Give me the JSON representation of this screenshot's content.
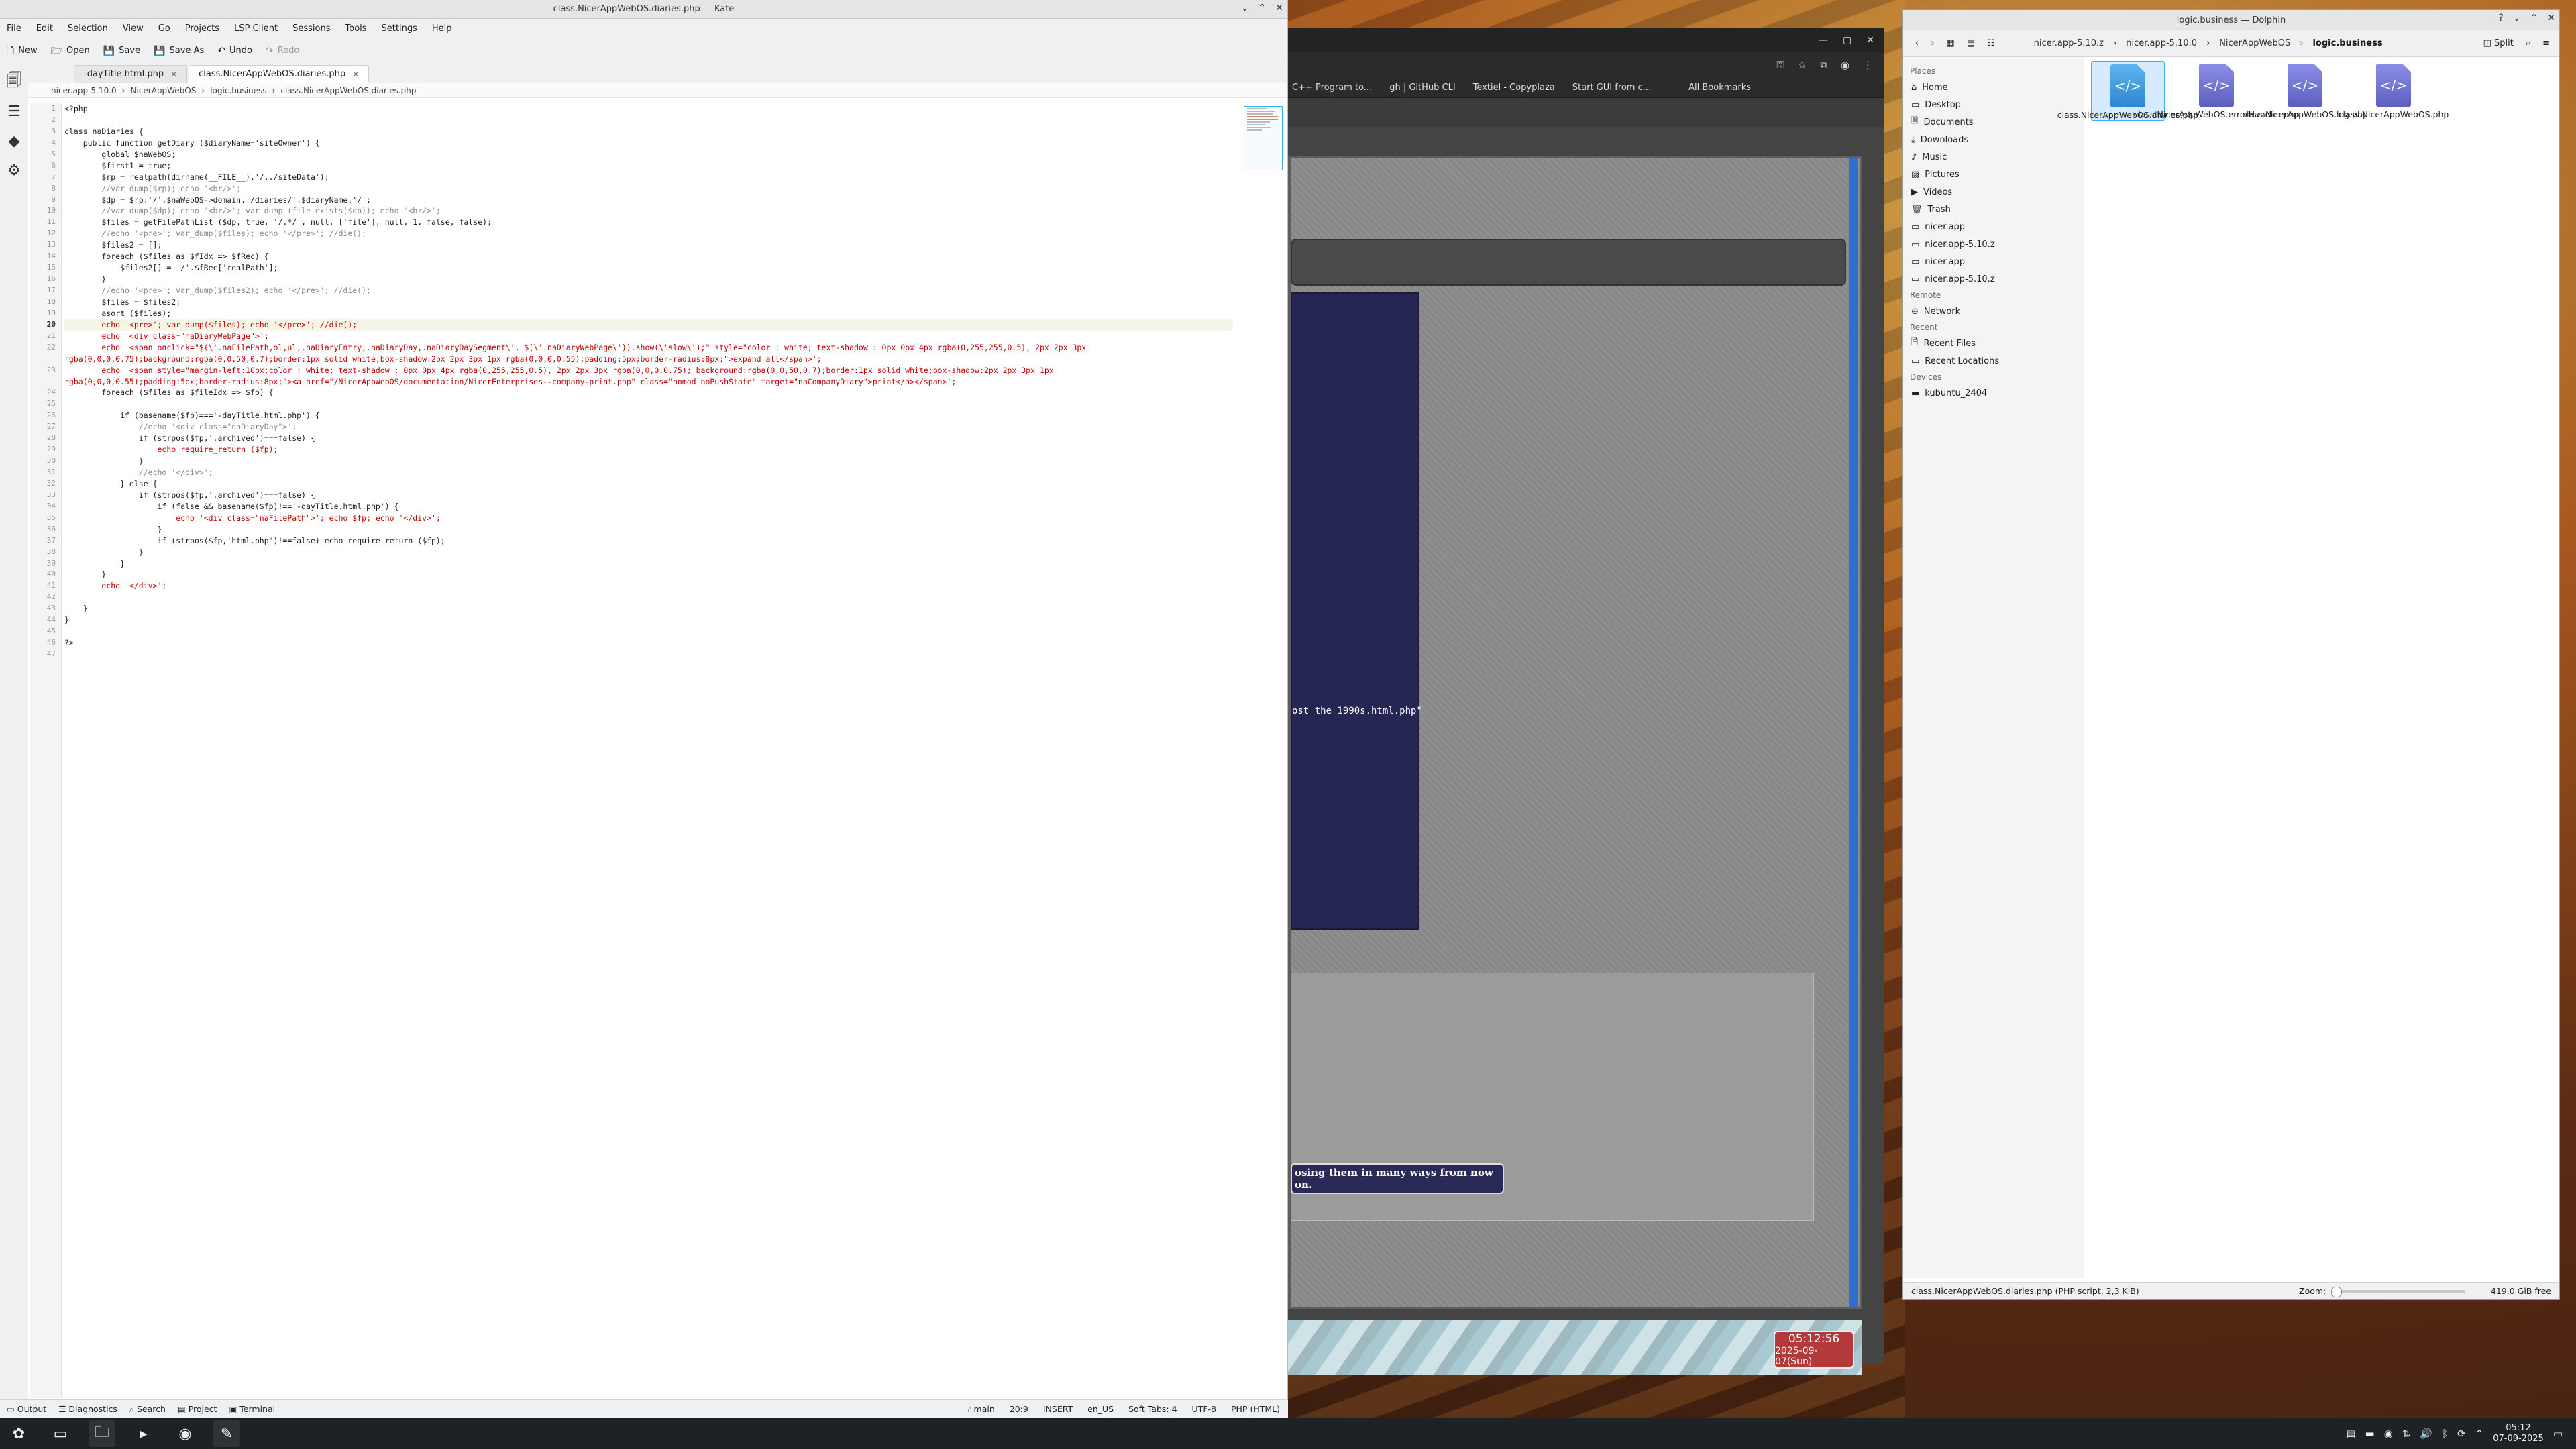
{
  "kate": {
    "title": "class.NicerAppWebOS.diaries.php — Kate",
    "menu": [
      "File",
      "Edit",
      "Selection",
      "View",
      "Go",
      "Projects",
      "LSP Client",
      "Sessions",
      "Tools",
      "Settings",
      "Help"
    ],
    "toolbar": {
      "new": "New",
      "open": "Open",
      "save": "Save",
      "save_as": "Save As",
      "undo": "Undo",
      "redo": "Redo"
    },
    "tabs": [
      "-dayTitle.html.php",
      "class.NicerAppWebOS.diaries.php"
    ],
    "breadcrumb": [
      "nicer.app-5.10.0",
      "NicerAppWebOS",
      "logic.business",
      "class.NicerAppWebOS.diaries.php"
    ],
    "current_line": 20,
    "code_lines": [
      "<?php",
      "",
      "class naDiaries {",
      "    public function getDiary ($diaryName='siteOwner') {",
      "        global $naWebOS;",
      "        $first1 = true;",
      "        $rp = realpath(dirname(__FILE__).'/../siteData');",
      "        //var_dump($rp); echo '<br/>';",
      "        $dp = $rp.'/'.$naWebOS->domain.'/diaries/'.$diaryName.'/';",
      "        //var_dump($dp); echo '<br/>'; var_dump (file_exists($dp)); echo '<br/>';",
      "        $files = getFilePathList ($dp, true, '/.*/', null, ['file'], null, 1, false, false);",
      "        //echo '<pre>'; var_dump($files); echo '</pre>'; //die();",
      "        $files2 = [];",
      "        foreach ($files as $fIdx => $fRec) {",
      "            $files2[] = '/'.$fRec['realPath'];",
      "        }",
      "        //echo '<pre>'; var_dump($files2); echo '</pre>'; //die();",
      "        $files = $files2;",
      "        asort ($files);",
      "        echo '<pre>'; var_dump($files); echo '</pre>'; //die();",
      "        echo '<div class=\"naDiaryWebPage\">';",
      "        echo '<span onclick=\"$(\\'.naFilePath,ol,ul,.naDiaryEntry,.naDiaryDay,.naDiaryDaySegment\\', $(\\'.naDiaryWebPage\\')).show(\\'slow\\');\" style=\"color : white; text-shadow : 0px 0px 4px rgba(0,255,255,0.5), 2px 2px 3px",
      "rgba(0,0,0,0.75);background:rgba(0,0,50,0.7);border:1px solid white;box-shadow:2px 2px 3px 1px rgba(0,0,0,0.55);padding:5px;border-radius:8px;\">expand all</span>';",
      "        echo '<span style=\"margin-left:10px;color : white; text-shadow : 0px 0px 4px rgba(0,255,255,0.5), 2px 2px 3px rgba(0,0,0,0.75); background:rgba(0,0,50,0.7);border:1px solid white;box-shadow:2px 2px 3px 1px",
      "rgba(0,0,0,0.55);padding:5px;border-radius:8px;\"><a href=\"/NicerAppWebOS/documentation/NicerEnterprises--company-print.php\" class=\"nomod noPushState\" target=\"naCompanyDiary\">print</a></span>';",
      "        foreach ($files as $fileIdx => $fp) {",
      "",
      "            if (basename($fp)==='-dayTitle.html.php') {",
      "                //echo '<div class=\"naDiaryDay\">';",
      "                if (strpos($fp,'.archived')===false) {",
      "                    echo require_return ($fp);",
      "                }",
      "                //echo '</div>';",
      "            } else {",
      "                if (strpos($fp,'.archived')===false) {",
      "                    if (false && basename($fp)!=='-dayTitle.html.php') {",
      "                        echo '<div class=\"naFilePath\">'; echo $fp; echo '</div>';",
      "                    }",
      "                    if (strpos($fp,'html.php')!==false) echo require_return ($fp);",
      "                }",
      "            }",
      "        }",
      "        echo '</div>';",
      "",
      "    }",
      "}",
      "",
      "?>",
      ""
    ],
    "line_numbers": [
      "1",
      "2",
      "3",
      "4",
      "5",
      "6",
      "7",
      "8",
      "9",
      "10",
      "11",
      "12",
      "13",
      "14",
      "15",
      "16",
      "17",
      "18",
      "19",
      "20",
      "21",
      "22",
      "",
      "23",
      "",
      "24",
      "25",
      "26",
      "27",
      "28",
      "29",
      "30",
      "31",
      "32",
      "33",
      "34",
      "35",
      "36",
      "37",
      "38",
      "39",
      "40",
      "41",
      "42",
      "43",
      "44",
      "45",
      "46",
      "47"
    ],
    "status": {
      "output": "Output",
      "diagnostics": "Diagnostics",
      "search": "Search",
      "project": "Project",
      "terminal": "Terminal",
      "branch": "main",
      "position": "20:9",
      "mode": "INSERT",
      "lang": "en_US",
      "tabs": "Soft Tabs: 4",
      "encoding": "UTF-8",
      "syntax": "PHP (HTML)"
    }
  },
  "browser": {
    "bookmarks": [
      "C++ Program to...",
      "gh | GitHub CLI",
      "Textiel - Copyplaza",
      "Start GUI from c...",
      "All Bookmarks"
    ],
    "navy_text": "ost the 1990s.html.php\"",
    "tooltip_text": "osing them in many ways from now on.",
    "clock_time": "05:12:56",
    "clock_date": "2025-09-07(Sun)"
  },
  "dolphin": {
    "title": "logic.business — Dolphin",
    "breadcrumb": [
      "nicer.app-5.10.z",
      "nicer.app-5.10.0",
      "NicerAppWebOS",
      "logic.business"
    ],
    "split_label": "Split",
    "places_header": "Places",
    "places": [
      "Home",
      "Desktop",
      "Documents",
      "Downloads",
      "Music",
      "Pictures",
      "Videos",
      "Trash",
      "nicer.app",
      "nicer.app-5.10.z",
      "nicer.app",
      "nicer.app-5.10.z"
    ],
    "remote_header": "Remote",
    "remote": [
      "Network"
    ],
    "recent_header": "Recent",
    "recent": [
      "Recent Files",
      "Recent Locations"
    ],
    "devices_header": "Devices",
    "devices": [
      "kubuntu_2404"
    ],
    "files": [
      {
        "name": "class.NicerAppWebOS.diaries.php",
        "selected": true
      },
      {
        "name": "class.NicerAppWebOS.errorHandler.php",
        "selected": false
      },
      {
        "name": "class.NicerAppWebOS.log.php",
        "selected": false
      },
      {
        "name": "class.NicerAppWebOS.php",
        "selected": false
      }
    ],
    "status_text": "class.NicerAppWebOS.diaries.php (PHP script, 2,3 KiB)",
    "zoom_label": "Zoom:",
    "free_space": "419,0 GiB free"
  },
  "taskbar": {
    "time": "05:12",
    "date": "07-09-2025"
  },
  "colors": {
    "accent": "#3daee9",
    "kde_bg": "#eff0f1",
    "navy": "#262654",
    "clock_red": "#b33a3a"
  }
}
